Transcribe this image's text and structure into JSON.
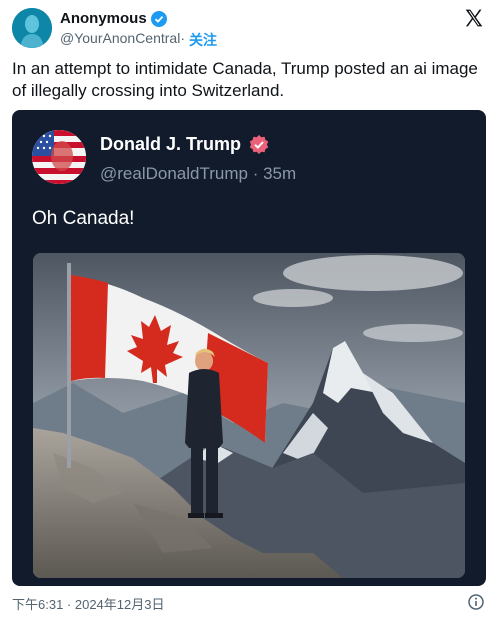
{
  "tweet": {
    "author_name": "Anonymous",
    "handle": "@YourAnonCentral",
    "separator": " · ",
    "follow_label": "关注",
    "text": "In an attempt to intimidate Canada, Trump posted an ai image of illegally crossing into Switzerland.",
    "timestamp": "下午6:31 · 2024年12月3日"
  },
  "quoted": {
    "author_name": "Donald J. Trump",
    "handle": "@realDonaldTrump",
    "separator": " · ",
    "time": "35m",
    "text": "Oh Canada!"
  },
  "colors": {
    "card_bg": "#111b2c",
    "verified_blue": "#1d9bf0",
    "verified_pink": "#e9627a",
    "flag_red": "#d52b1e"
  }
}
